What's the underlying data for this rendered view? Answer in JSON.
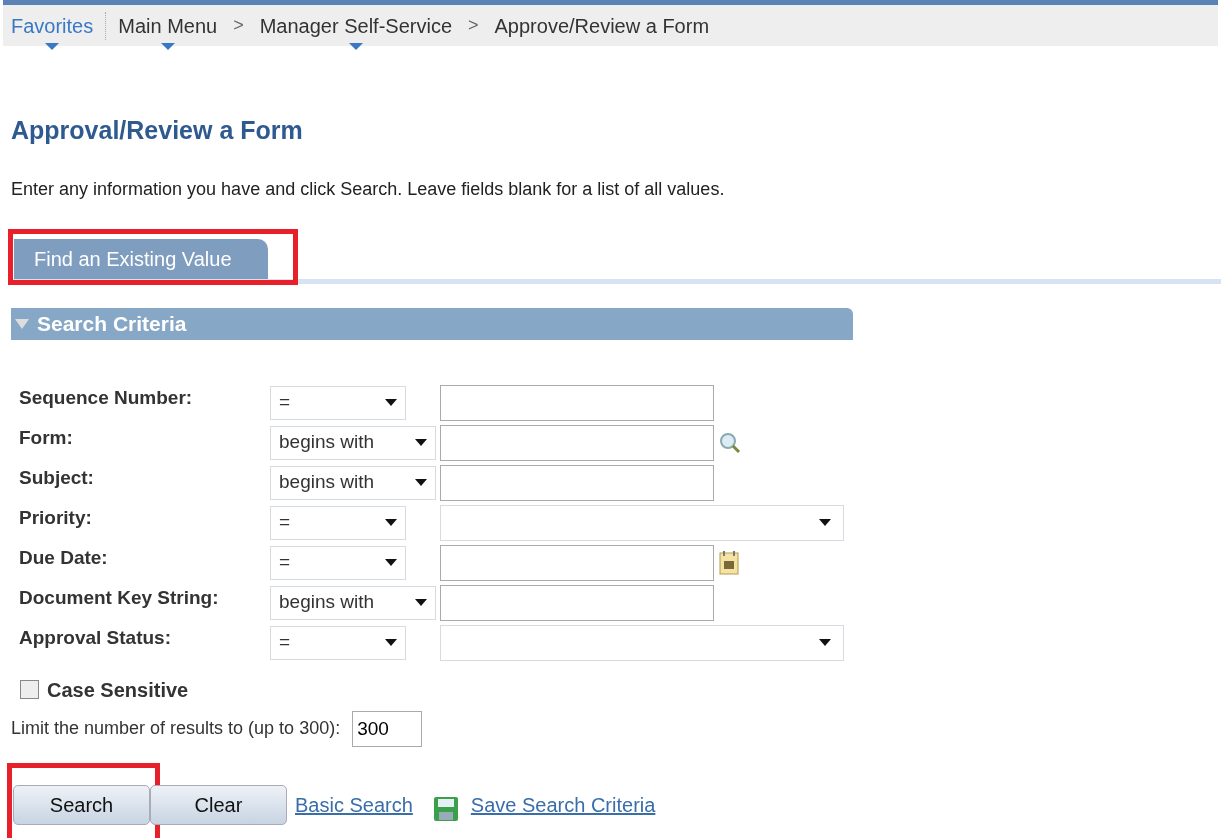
{
  "breadcrumbs": [
    {
      "label": "Favorites",
      "menu": true,
      "kind": "link"
    },
    {
      "label": "Main Menu",
      "menu": true,
      "kind": "plain"
    },
    {
      "label": "Manager Self-Service",
      "menu": true,
      "kind": "plain",
      "separator": ">"
    },
    {
      "label": "Approve/Review a Form",
      "menu": false,
      "kind": "plain",
      "separator": ">"
    }
  ],
  "page_title": "Approval/Review a Form",
  "instructions": "Enter any information you have and click Search. Leave fields blank for a list of all values.",
  "tabs": [
    {
      "label": "Find an Existing Value",
      "selected": true,
      "highlighted": true
    }
  ],
  "section": {
    "title": "Search Criteria",
    "expanded": true
  },
  "fields": [
    {
      "label": "Sequence Number:",
      "operator": "=",
      "kind": "text"
    },
    {
      "label": "Form:",
      "operator": "begins with",
      "kind": "lookup"
    },
    {
      "label": "Subject:",
      "operator": "begins with",
      "kind": "text"
    },
    {
      "label": "Priority:",
      "operator": "=",
      "kind": "select"
    },
    {
      "label": "Due Date:",
      "operator": "=",
      "kind": "date"
    },
    {
      "label": "Document Key String:",
      "operator": "begins with",
      "kind": "text"
    },
    {
      "label": "Approval Status:",
      "operator": "=",
      "kind": "select"
    }
  ],
  "case_sensitive": {
    "label": "Case Sensitive",
    "checked": false
  },
  "limit": {
    "label": "Limit the number of results to (up to 300):",
    "value": "300"
  },
  "buttons": [
    {
      "label": "Search",
      "highlighted": true
    },
    {
      "label": "Clear",
      "highlighted": false
    }
  ],
  "links": [
    {
      "label": "Basic Search",
      "kind": "plain"
    },
    {
      "label": "Save Search Criteria",
      "kind": "save"
    }
  ]
}
